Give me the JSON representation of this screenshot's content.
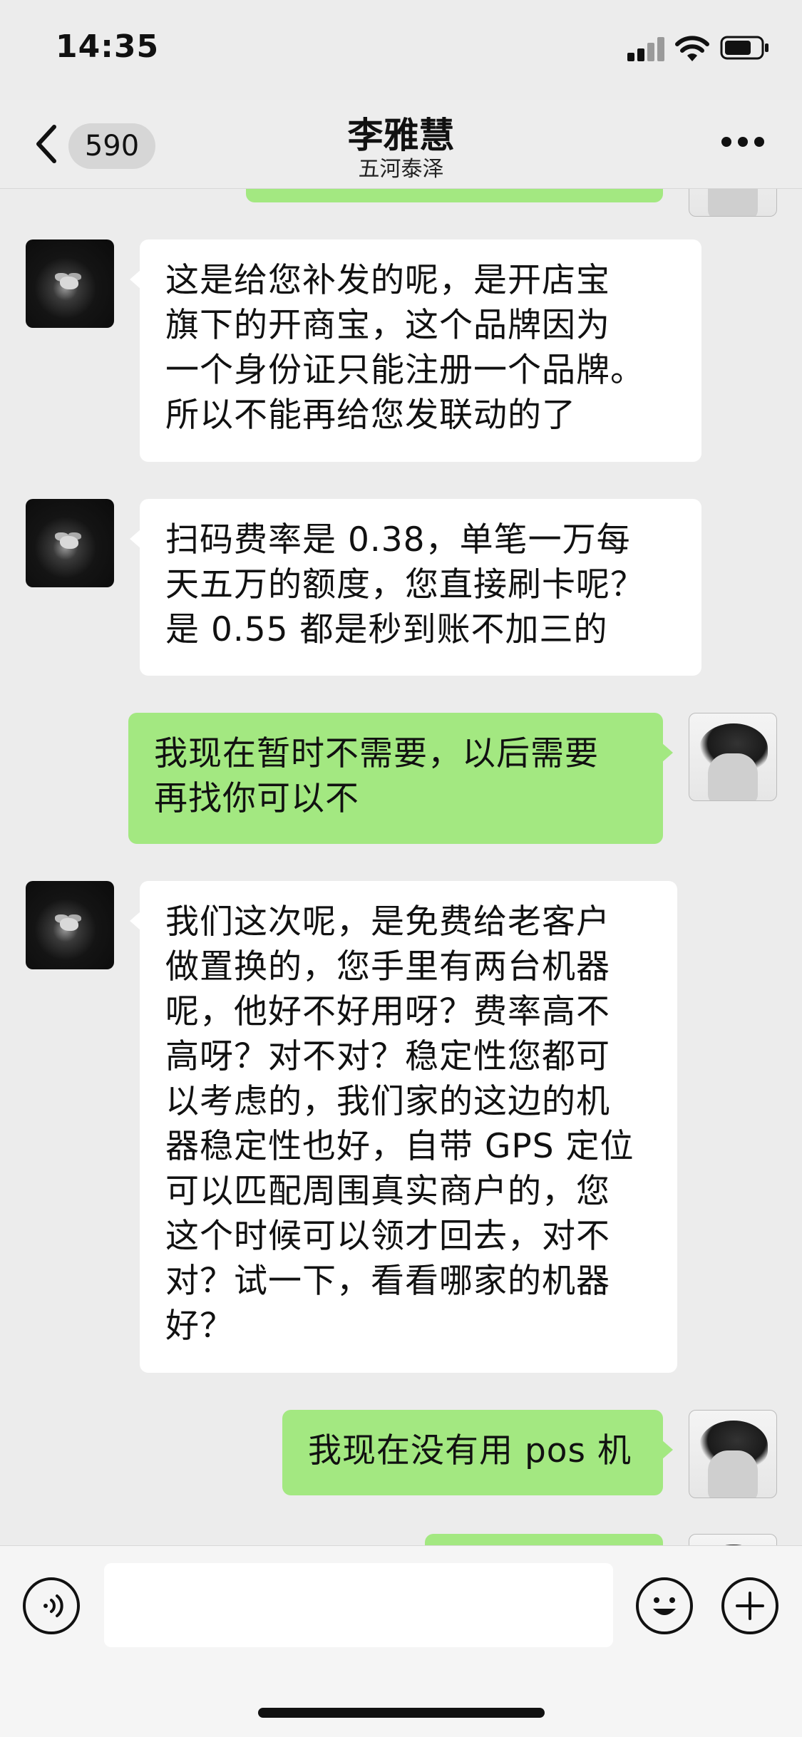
{
  "status_bar": {
    "time": "14:35"
  },
  "header": {
    "back_count": "590",
    "contact_name": "李雅慧",
    "contact_subtitle": "五河泰泽"
  },
  "messages": [
    {
      "side": "left",
      "text": "这是给您补发的呢，是开店宝\n旗下的开商宝，这个品牌因为\n一个身份证只能注册一个品牌。\n所以不能再给您发联动的了"
    },
    {
      "side": "left",
      "text": "扫码费率是 0.38，单笔一万每\n天五万的额度，您直接刷卡呢？\n是 0.55 都是秒到账不加三的"
    },
    {
      "side": "right",
      "text": "我现在暂时不需要，以后需要\n再找你可以不"
    },
    {
      "side": "left",
      "text": "我们这次呢，是免费给老客户\n做置换的，您手里有两台机器\n呢，他好不好用呀？费率高不\n高呀？对不对？稳定性您都可\n以考虑的，我们家的这边的机\n器稳定性也好，自带 GPS 定位\n可以匹配周围真实商户的，您\n这个时候可以领才回去，对不\n对？试一下，看看哪家的机器\n好？"
    },
    {
      "side": "right",
      "text": "我现在没有用 pos 机"
    }
  ],
  "colors": {
    "sent_bubble": "#a3e881",
    "received_bubble": "#ffffff",
    "background": "#ececec"
  },
  "icons": {
    "back": "chevron-left-icon",
    "more": "more-dots-icon",
    "voice": "voice-icon",
    "emoji": "emoji-icon",
    "plus": "plus-icon"
  }
}
